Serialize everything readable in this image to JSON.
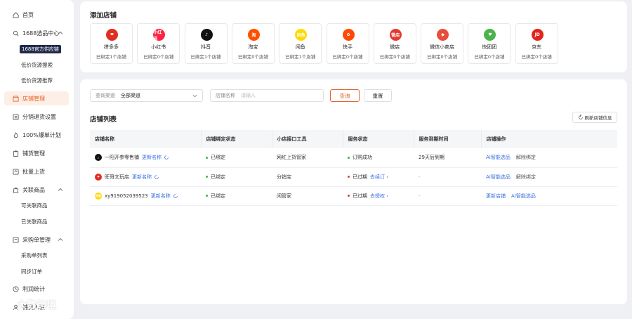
{
  "sidebar": {
    "items": [
      {
        "label": "首页",
        "icon": "home-icon"
      },
      {
        "label": "1688选品中心",
        "icon": "search-icon"
      },
      {
        "label": "店铺管理",
        "icon": "store-icon"
      },
      {
        "label": "分销退货设置",
        "icon": "return-icon"
      },
      {
        "label": "100%爆单计划",
        "icon": "fire-icon"
      },
      {
        "label": "铺货管理",
        "icon": "clipboard-icon"
      },
      {
        "label": "批量上货",
        "icon": "upload-icon"
      },
      {
        "label": "关联商品",
        "icon": "bag-icon"
      },
      {
        "label": "采购单管理",
        "icon": "cart-icon"
      },
      {
        "label": "利润统计",
        "icon": "clock-icon"
      },
      {
        "label": "铺货入驻",
        "icon": "user-icon"
      }
    ],
    "subitems": {
      "sourcing_badge": "1688官方供应链",
      "low_price_search": "低价货源搜索",
      "low_price_recommend": "低价货源推荐",
      "linkable_goods": "可关联商品",
      "linked_goods": "已关联商品",
      "purchase_list": "采购单列表",
      "sync_orders": "同步订单"
    }
  },
  "add_shop": {
    "title": "添加店铺",
    "platforms": [
      {
        "name": "拼多多",
        "stat": "已绑定1个店铺",
        "color": "#e02e24",
        "logo": "❤"
      },
      {
        "name": "小红书",
        "stat": "已绑定0个店铺",
        "color": "#ff2442",
        "logo": "小红书"
      },
      {
        "name": "抖音",
        "stat": "已绑定1个店铺",
        "color": "#111111",
        "logo": "♪"
      },
      {
        "name": "淘宝",
        "stat": "已绑定0个店铺",
        "color": "#ff5000",
        "logo": "淘"
      },
      {
        "name": "闲鱼",
        "stat": "已绑定1个店铺",
        "color": "#ffda00",
        "logo": "闲鱼"
      },
      {
        "name": "快手",
        "stat": "已绑定0个店铺",
        "color": "#ff4906",
        "logo": "✿"
      },
      {
        "name": "微店",
        "stat": "已绑定0个店铺",
        "color": "#e33b2e",
        "logo": "微店"
      },
      {
        "name": "微信小商店",
        "stat": "已绑定0个店铺",
        "color": "#e94e3b",
        "logo": "◆"
      },
      {
        "name": "快团团",
        "stat": "已绑定0个店铺",
        "color": "#4cb34a",
        "logo": "♥"
      },
      {
        "name": "京东",
        "stat": "已绑定0个店铺",
        "color": "#e1251b",
        "logo": "JD"
      }
    ]
  },
  "filters": {
    "channel_label": "查询渠道",
    "channel_value": "全部渠道",
    "shop_name_label": "店铺名称",
    "shop_name_placeholder": "请输入",
    "query_label": "查询",
    "reset_label": "重置"
  },
  "shop_list": {
    "title": "店铺列表",
    "refresh_label": "刷新店铺信息",
    "columns": [
      "店铺名称",
      "店铺绑定状态",
      "小店接口工具",
      "服务状态",
      "服务到期时间",
      "店铺操作"
    ],
    "rows": [
      {
        "logo": "♪",
        "logo_color": "#111111",
        "name": "一阳开参零售铺",
        "update_link": "更新名称",
        "bind_status": "已绑定",
        "tool": "网红上货管家",
        "service_status": "订购成功",
        "service_color": "green",
        "renew_link": "",
        "expire": "29天后到期",
        "op1": "AI智能选品",
        "op2": "解除绑定"
      },
      {
        "logo": "❤",
        "logo_color": "#e02e24",
        "name": "旺哥文玩店",
        "update_link": "更新名称",
        "bind_status": "已绑定",
        "tool": "分销宝",
        "service_status": "已过期",
        "service_color": "red",
        "renew_link": "去续订 ›",
        "expire": "-",
        "op1": "AI智能选品",
        "op2": "解除绑定"
      },
      {
        "logo": "闲鱼",
        "logo_color": "#ffda00",
        "name": "xy919052039523",
        "update_link": "更新名称",
        "bind_status": "已绑定",
        "tool": "闲管家",
        "service_status": "已过期",
        "service_color": "red",
        "renew_link": "去授权 ›",
        "expire": "-",
        "op1": "更新店铺",
        "op2": "AI智能选品"
      }
    ]
  },
  "watermark": "大数跨境"
}
